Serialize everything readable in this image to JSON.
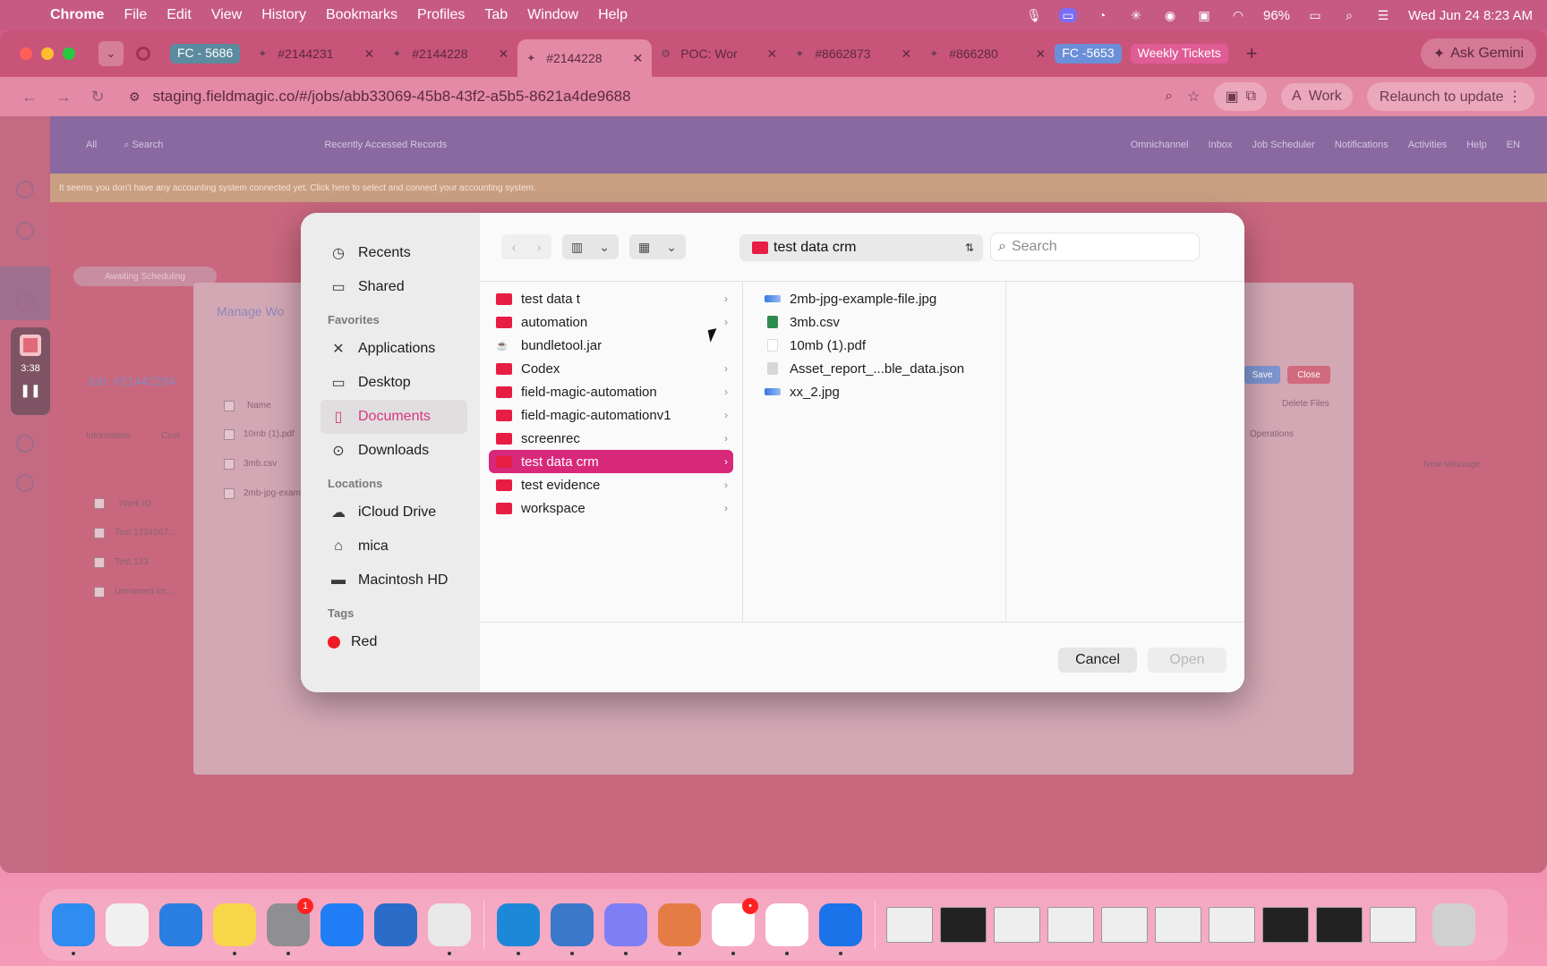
{
  "menubar": {
    "app": "Chrome",
    "items": [
      "File",
      "Edit",
      "View",
      "History",
      "Bookmarks",
      "Profiles",
      "Tab",
      "Window",
      "Help"
    ],
    "battery": "96%",
    "datetime": "Wed Jun 24  8:23 AM"
  },
  "tabs": {
    "group1": "FC - 5686",
    "tab1": "#2144231",
    "tab2": "#2144228",
    "tab3": "#2144228",
    "tab4": "POC: Wor",
    "tab5": "#8662873",
    "tab6": "#866280",
    "group2": "FC -5653",
    "group3": "Weekly Tickets",
    "ask_gemini": "Ask Gemini"
  },
  "toolbar": {
    "url": "staging.fieldmagic.co/#/jobs/abb33069-45b8-43f2-a5b5-8621a4de9688",
    "profile": "Work",
    "relaunch": "Relaunch to update"
  },
  "background_page": {
    "filter": "All",
    "search": "Search",
    "recent": "Recently Accessed Records",
    "header_items": [
      "Omnichannel",
      "Inbox",
      "Job Scheduler",
      "Notifications",
      "Activities",
      "Help",
      "EN"
    ],
    "warning": "It seems you don't have any accounting system connected yet. Click here to select and connect your accounting system.",
    "chip": "Awaiting Scheduling",
    "manage_title": "Manage Wo",
    "job_title": "Job: #21442284",
    "tab_info": "Information",
    "tab_cost": "Cost",
    "col_name": "Name",
    "files": [
      "10mb (1).pdf",
      "3mb.csv",
      "2mb-jpg-exam"
    ],
    "col_workid": "Work ID",
    "work_rows": [
      "Test 1234567...",
      "Test 123",
      "Unnamed loc..."
    ],
    "save": "Save",
    "close": "Close",
    "delete_files": "Delete Files",
    "operations": "Operations",
    "new_message": "New Message",
    "timer": "3:38"
  },
  "dialog": {
    "sidebar": {
      "recents": "Recents",
      "shared": "Shared",
      "favorites_head": "Favorites",
      "applications": "Applications",
      "desktop": "Desktop",
      "documents": "Documents",
      "downloads": "Downloads",
      "locations_head": "Locations",
      "icloud": "iCloud Drive",
      "home": "mica",
      "hd": "Macintosh HD",
      "tags_head": "Tags",
      "tag_red": "Red"
    },
    "path": "test data crm",
    "search_placeholder": "Search",
    "col1": [
      {
        "name": "test data t",
        "type": "folder"
      },
      {
        "name": "automation",
        "type": "folder"
      },
      {
        "name": "bundletool.jar",
        "type": "file"
      },
      {
        "name": "Codex",
        "type": "folder"
      },
      {
        "name": "field-magic-automation",
        "type": "folder"
      },
      {
        "name": "field-magic-automationv1",
        "type": "folder"
      },
      {
        "name": "screenrec",
        "type": "folder"
      },
      {
        "name": "test data crm",
        "type": "folder",
        "selected": true
      },
      {
        "name": "test evidence",
        "type": "folder"
      },
      {
        "name": "workspace",
        "type": "folder"
      }
    ],
    "col2": [
      {
        "name": "2mb-jpg-example-file.jpg",
        "type": "img"
      },
      {
        "name": "3mb.csv",
        "type": "csv"
      },
      {
        "name": "10mb (1).pdf",
        "type": "pdf"
      },
      {
        "name": "Asset_report_...ble_data.json",
        "type": "file"
      },
      {
        "name": "xx_2.jpg",
        "type": "img"
      }
    ],
    "cancel": "Cancel",
    "open": "Open"
  }
}
